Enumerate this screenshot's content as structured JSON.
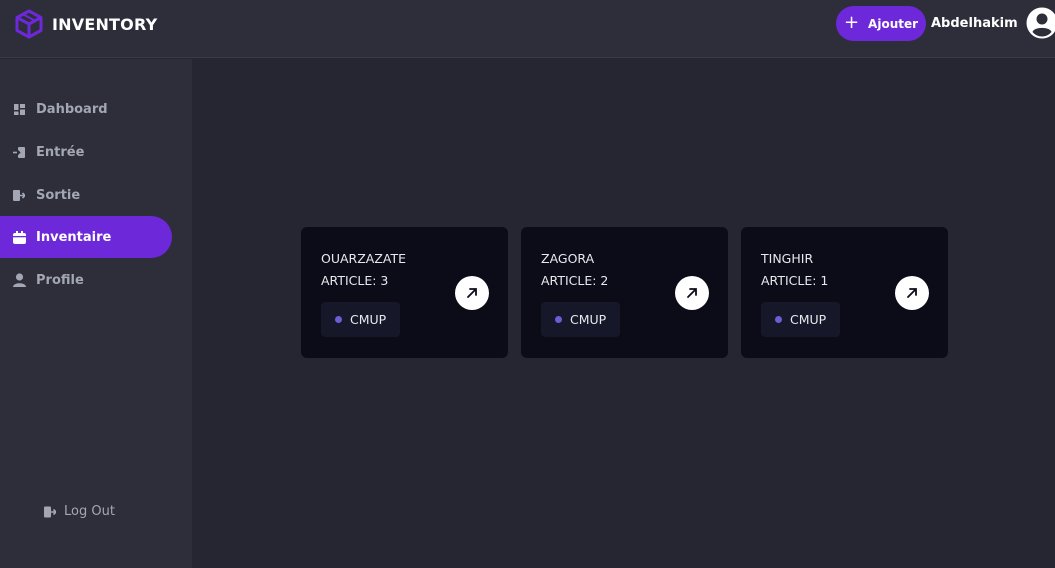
{
  "header": {
    "app_name": "INVENTORY",
    "add_label": "Ajouter",
    "user_name": "Abdelhakim"
  },
  "sidebar": {
    "items": [
      {
        "label": "Dahboard",
        "icon": "dashboard-icon"
      },
      {
        "label": "Entrée",
        "icon": "login-icon"
      },
      {
        "label": "Sortie",
        "icon": "logout-icon"
      },
      {
        "label": "Inventaire",
        "icon": "calendar-icon",
        "active": true
      },
      {
        "label": "Profile",
        "icon": "user-icon"
      }
    ],
    "logout_label": "Log Out"
  },
  "cards": [
    {
      "title": "OUARZAZATE",
      "count": "ARTICLE: 3",
      "badge": "CMUP"
    },
    {
      "title": "ZAGORA",
      "count": "ARTICLE: 2",
      "badge": "CMUP"
    },
    {
      "title": "TINGHIR",
      "count": "ARTICLE: 1",
      "badge": "CMUP"
    }
  ],
  "colors": {
    "accent": "#6d28d9",
    "background": "#252631",
    "panel": "#2d2e39",
    "card": "#0b0c18"
  }
}
